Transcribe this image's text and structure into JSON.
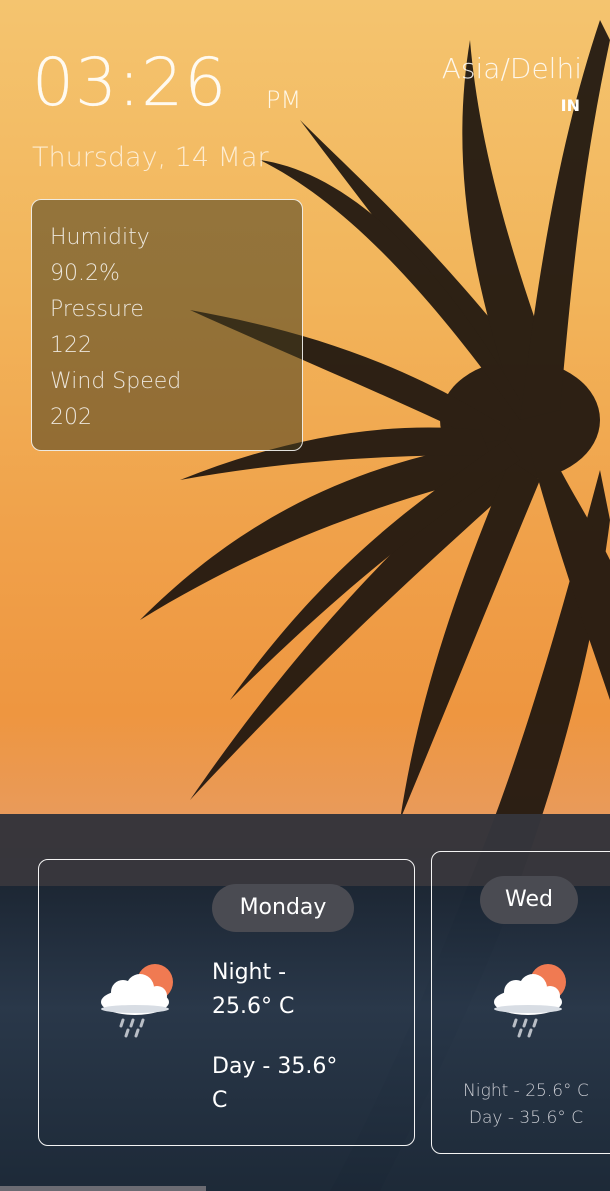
{
  "clock": {
    "time": "03:26",
    "ampm": "PM"
  },
  "location": {
    "timezone": "Asia/Delhi",
    "country": "IN"
  },
  "date": "Thursday, 14 Mar",
  "details": {
    "humidity_label": "Humidity",
    "humidity_value": "90.2%",
    "pressure_label": "Pressure",
    "pressure_value": "122",
    "wind_label": "Wind Speed",
    "wind_value": "202"
  },
  "forecast": [
    {
      "day": "Monday",
      "night_line1": "Night -",
      "night_line2": "25.6° C",
      "day_line1": "Day - 35.6°",
      "day_line2": "C",
      "icon": "cloud-rain-sun-icon"
    },
    {
      "day": "Wed",
      "night": "Night - 25.6° C",
      "day_temp": "Day - 35.6° C",
      "icon": "cloud-rain-sun-icon"
    }
  ],
  "colors": {
    "sky_top": "#f4c46f",
    "sky_mid": "#ee9640",
    "card_border": "#f4f4f4",
    "pill_bg": "#4a4b52",
    "sun": "#f07a52"
  }
}
